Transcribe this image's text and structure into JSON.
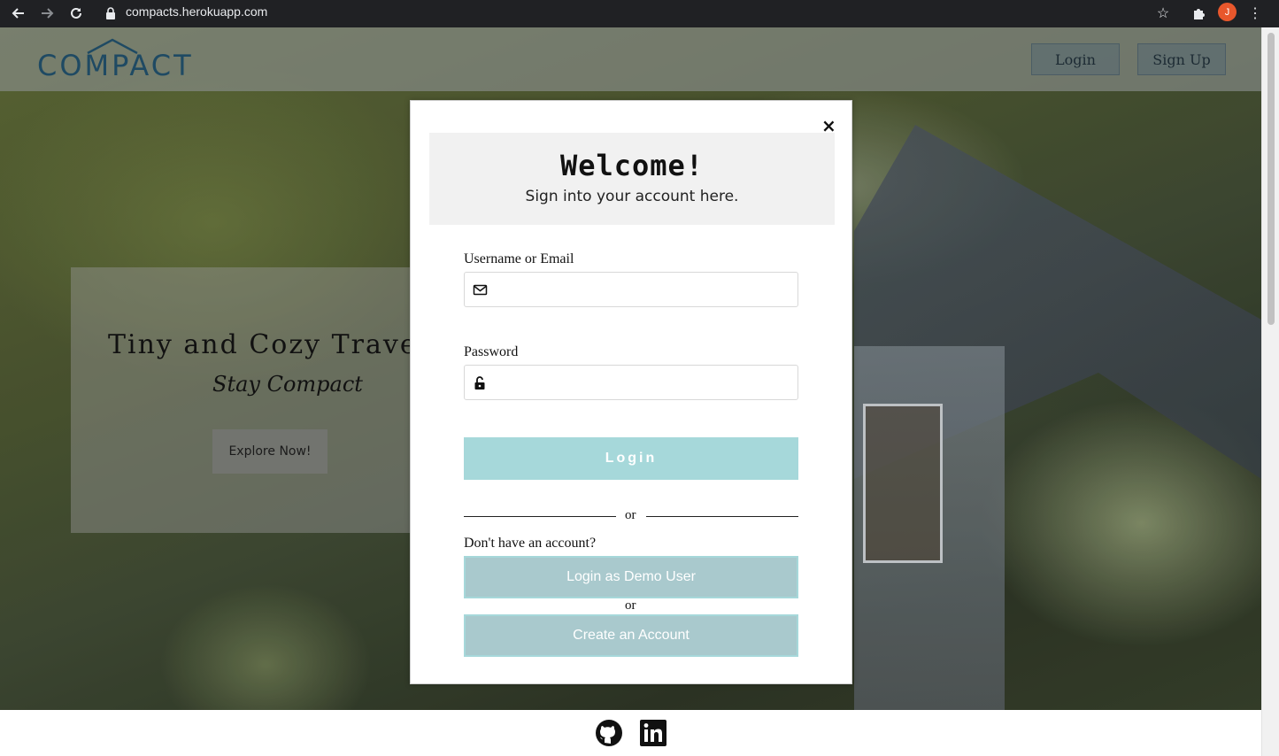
{
  "browser": {
    "url": "compacts.herokuapp.com",
    "profile_initial": "J",
    "icons": [
      "back-icon",
      "forward-icon",
      "reload-icon",
      "lock-icon",
      "star-icon",
      "extensions-icon",
      "menu-icon"
    ]
  },
  "header": {
    "logo_text": "COMPACT",
    "login_label": "Login",
    "signup_label": "Sign Up"
  },
  "promo": {
    "title": "Tiny and Cozy Travel",
    "subtitle": "Stay Compact",
    "explore_label": "Explore Now!"
  },
  "modal": {
    "close_glyph": "×",
    "title": "Welcome!",
    "subtitle": "Sign into your account here.",
    "username_label": "Username or Email",
    "username_value": "",
    "password_label": "Password",
    "password_value": "",
    "login_label": "Login",
    "or_label": "or",
    "no_account_label": "Don't have an account?",
    "demo_label": "Login as Demo User",
    "create_label": "Create an Account"
  },
  "footer": {
    "icons": [
      "github-icon",
      "linkedin-icon"
    ]
  },
  "colors": {
    "accent": "#a6d8da",
    "secondary_button": "#a9c9cd",
    "logo": "#1f4a63"
  }
}
